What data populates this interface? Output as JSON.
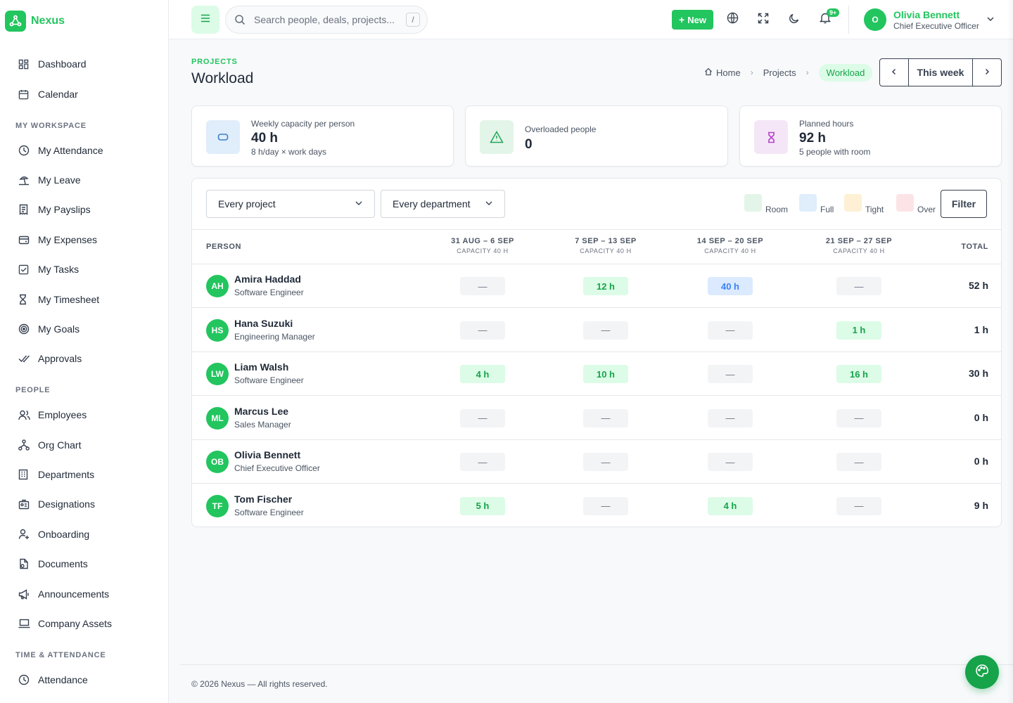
{
  "app": {
    "name": "Nexus"
  },
  "sidebar": {
    "top_items": [
      {
        "label": "Dashboard",
        "icon": "dashboard-icon"
      },
      {
        "label": "Calendar",
        "icon": "calendar-icon"
      }
    ],
    "sections": [
      {
        "title": "MY WORKSPACE",
        "items": [
          {
            "label": "My Attendance",
            "icon": "clock-icon"
          },
          {
            "label": "My Leave",
            "icon": "beach-icon"
          },
          {
            "label": "My Payslips",
            "icon": "receipt-icon"
          },
          {
            "label": "My Expenses",
            "icon": "wallet-icon"
          },
          {
            "label": "My Tasks",
            "icon": "checkbox-icon"
          },
          {
            "label": "My Timesheet",
            "icon": "hourglass-icon"
          },
          {
            "label": "My Goals",
            "icon": "target-icon"
          },
          {
            "label": "Approvals",
            "icon": "double-check-icon"
          }
        ]
      },
      {
        "title": "PEOPLE",
        "items": [
          {
            "label": "Employees",
            "icon": "users-icon"
          },
          {
            "label": "Org Chart",
            "icon": "hierarchy-icon"
          },
          {
            "label": "Departments",
            "icon": "building-icon"
          },
          {
            "label": "Designations",
            "icon": "badge-icon"
          },
          {
            "label": "Onboarding",
            "icon": "user-plus-icon"
          },
          {
            "label": "Documents",
            "icon": "document-icon"
          },
          {
            "label": "Announcements",
            "icon": "megaphone-icon"
          },
          {
            "label": "Company Assets",
            "icon": "laptop-icon"
          }
        ]
      },
      {
        "title": "TIME & ATTENDANCE",
        "items": [
          {
            "label": "Attendance",
            "icon": "clock-icon"
          }
        ]
      }
    ]
  },
  "topbar": {
    "search_placeholder": "Search people, deals, projects...",
    "search_shortcut": "/",
    "new_label": "New",
    "notification_count": "9+",
    "user": {
      "initial": "O",
      "name": "Olivia Bennett",
      "role": "Chief Executive Officer"
    }
  },
  "page": {
    "section": "PROJECTS",
    "title": "Workload",
    "breadcrumb": {
      "home": "Home",
      "parent": "Projects",
      "current": "Workload"
    },
    "week_label": "This week"
  },
  "stats": [
    {
      "label": "Weekly capacity per person",
      "value": "40 h",
      "sub": "8 h/day × work days",
      "icon": "pill-icon",
      "bg": "#e0edfb",
      "fg": "#3b7fd1"
    },
    {
      "label": "Overloaded people",
      "value": "0",
      "sub": "",
      "icon": "warning-icon",
      "bg": "#e3f5e8",
      "fg": "#22a55a"
    },
    {
      "label": "Planned hours",
      "value": "92 h",
      "sub": "5 people with room",
      "icon": "hourglass-icon",
      "bg": "#f5e6f7",
      "fg": "#b445c9"
    }
  ],
  "filters": {
    "project": "Every project",
    "department": "Every department",
    "filter_label": "Filter"
  },
  "legend": [
    {
      "label": "Room",
      "color": "#e3f5e8"
    },
    {
      "label": "Full",
      "color": "#e0edfb"
    },
    {
      "label": "Tight",
      "color": "#fdf0d5"
    },
    {
      "label": "Over",
      "color": "#fce4e6"
    }
  ],
  "table": {
    "person_header": "PERSON",
    "total_header": "TOTAL",
    "weeks": [
      {
        "range": "31 AUG – 6 SEP",
        "capacity": "CAPACITY 40 H"
      },
      {
        "range": "7 SEP – 13 SEP",
        "capacity": "CAPACITY 40 H"
      },
      {
        "range": "14 SEP – 20 SEP",
        "capacity": "CAPACITY 40 H"
      },
      {
        "range": "21 SEP – 27 SEP",
        "capacity": "CAPACITY 40 H"
      }
    ],
    "rows": [
      {
        "initials": "AH",
        "name": "Amira Haddad",
        "role": "Software Engineer",
        "cells": [
          {
            "text": "—",
            "state": "empty"
          },
          {
            "text": "12 h",
            "state": "room"
          },
          {
            "text": "40 h",
            "state": "full"
          },
          {
            "text": "—",
            "state": "empty"
          }
        ],
        "total": "52 h"
      },
      {
        "initials": "HS",
        "name": "Hana Suzuki",
        "role": "Engineering Manager",
        "cells": [
          {
            "text": "—",
            "state": "empty"
          },
          {
            "text": "—",
            "state": "empty"
          },
          {
            "text": "—",
            "state": "empty"
          },
          {
            "text": "1 h",
            "state": "room"
          }
        ],
        "total": "1 h"
      },
      {
        "initials": "LW",
        "name": "Liam Walsh",
        "role": "Software Engineer",
        "cells": [
          {
            "text": "4 h",
            "state": "room"
          },
          {
            "text": "10 h",
            "state": "room"
          },
          {
            "text": "—",
            "state": "empty"
          },
          {
            "text": "16 h",
            "state": "room"
          }
        ],
        "total": "30 h"
      },
      {
        "initials": "ML",
        "name": "Marcus Lee",
        "role": "Sales Manager",
        "cells": [
          {
            "text": "—",
            "state": "empty"
          },
          {
            "text": "—",
            "state": "empty"
          },
          {
            "text": "—",
            "state": "empty"
          },
          {
            "text": "—",
            "state": "empty"
          }
        ],
        "total": "0 h"
      },
      {
        "initials": "OB",
        "name": "Olivia Bennett",
        "role": "Chief Executive Officer",
        "cells": [
          {
            "text": "—",
            "state": "empty"
          },
          {
            "text": "—",
            "state": "empty"
          },
          {
            "text": "—",
            "state": "empty"
          },
          {
            "text": "—",
            "state": "empty"
          }
        ],
        "total": "0 h"
      },
      {
        "initials": "TF",
        "name": "Tom Fischer",
        "role": "Software Engineer",
        "cells": [
          {
            "text": "5 h",
            "state": "room"
          },
          {
            "text": "—",
            "state": "empty"
          },
          {
            "text": "4 h",
            "state": "room"
          },
          {
            "text": "—",
            "state": "empty"
          }
        ],
        "total": "9 h"
      }
    ]
  },
  "footer": {
    "text": "© 2026 Nexus — All rights reserved."
  },
  "colors": {
    "accent": "#22c55e",
    "accent_dark": "#16a34a"
  }
}
